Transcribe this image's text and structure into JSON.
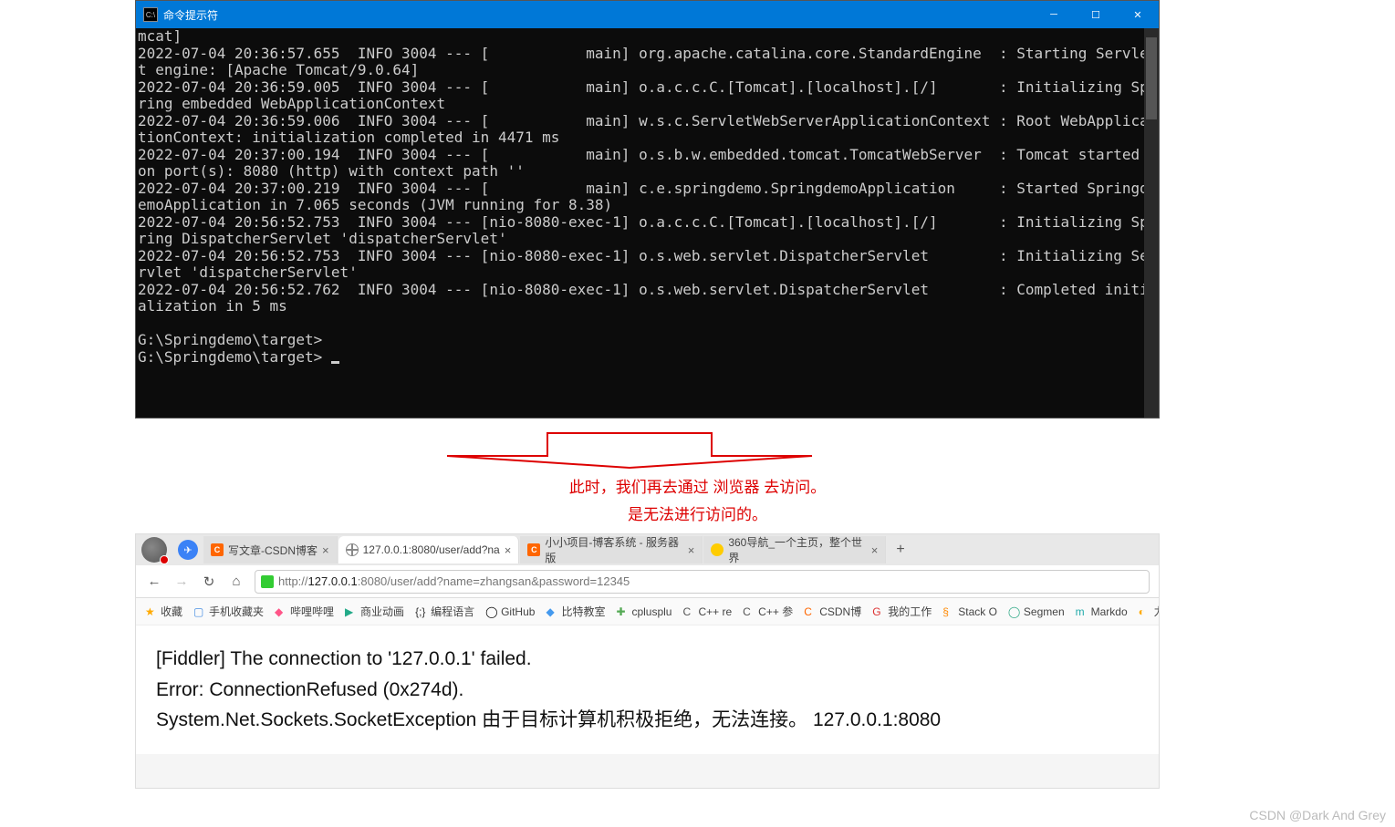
{
  "cmd": {
    "title": "命令提示符",
    "icon_text": "C:\\",
    "log": "mcat]\n2022-07-04 20:36:57.655  INFO 3004 --- [           main] org.apache.catalina.core.StandardEngine  : Starting Servlet engine: [Apache Tomcat/9.0.64]\n2022-07-04 20:36:59.005  INFO 3004 --- [           main] o.a.c.c.C.[Tomcat].[localhost].[/]       : Initializing Spring embedded WebApplicationContext\n2022-07-04 20:36:59.006  INFO 3004 --- [           main] w.s.c.ServletWebServerApplicationContext : Root WebApplicationContext: initialization completed in 4471 ms\n2022-07-04 20:37:00.194  INFO 3004 --- [           main] o.s.b.w.embedded.tomcat.TomcatWebServer  : Tomcat started on port(s): 8080 (http) with context path ''\n2022-07-04 20:37:00.219  INFO 3004 --- [           main] c.e.springdemo.SpringdemoApplication     : Started SpringdemoApplication in 7.065 seconds (JVM running for 8.38)\n2022-07-04 20:56:52.753  INFO 3004 --- [nio-8080-exec-1] o.a.c.c.C.[Tomcat].[localhost].[/]       : Initializing Spring DispatcherServlet 'dispatcherServlet'\n2022-07-04 20:56:52.753  INFO 3004 --- [nio-8080-exec-1] o.s.web.servlet.DispatcherServlet        : Initializing Servlet 'dispatcherServlet'\n2022-07-04 20:56:52.762  INFO 3004 --- [nio-8080-exec-1] o.s.web.servlet.DispatcherServlet        : Completed initialization in 5 ms\n\nG:\\Springdemo\\target>\nG:\\Springdemo\\target> "
  },
  "annotation": {
    "line1": "此时，我们再去通过 浏览器 去访问。",
    "line2": "是无法进行访问的。"
  },
  "browser": {
    "tabs": [
      {
        "label": "写文章-CSDN博客",
        "fav": "orange",
        "fav_text": "C"
      },
      {
        "label": "127.0.0.1:8080/user/add?na",
        "fav": "globe"
      },
      {
        "label": "小小项目-博客系统 - 服务器版",
        "fav": "orange",
        "fav_text": "C"
      },
      {
        "label": "360导航_一个主页，整个世界",
        "fav": "yellow"
      }
    ],
    "url_prefix": "http://",
    "url_host": "127.0.0.1",
    "url_rest": ":8080/user/add?name=zhangsan&password=12345",
    "bookmarks": [
      {
        "text": "收藏",
        "color": "#fa0",
        "glyph": "★"
      },
      {
        "text": "手机收藏夹",
        "color": "#4a90e2",
        "glyph": "▢"
      },
      {
        "text": "哔哩哔哩",
        "color": "#f58",
        "glyph": "◆"
      },
      {
        "text": "商业动画",
        "color": "#2a8",
        "glyph": "▶"
      },
      {
        "text": "编程语言",
        "color": "#333",
        "glyph": "{;}"
      },
      {
        "text": "GitHub",
        "color": "#000",
        "glyph": "◯"
      },
      {
        "text": "比特教室",
        "color": "#49e",
        "glyph": "◆"
      },
      {
        "text": "cplusplu",
        "color": "#5a5",
        "glyph": "✚"
      },
      {
        "text": "C++ re",
        "color": "#555",
        "glyph": "C"
      },
      {
        "text": "C++ 参",
        "color": "#555",
        "glyph": "C"
      },
      {
        "text": "CSDN博",
        "color": "#f60",
        "glyph": "C"
      },
      {
        "text": "我的工作",
        "color": "#d33",
        "glyph": "G"
      },
      {
        "text": "Stack O",
        "color": "#f80",
        "glyph": "§"
      },
      {
        "text": "Segmen",
        "color": "#3a8",
        "glyph": "◯"
      },
      {
        "text": "Markdo",
        "color": "#2aa",
        "glyph": "m"
      },
      {
        "text": "力扣 (",
        "color": "#fa0",
        "glyph": "◐"
      }
    ],
    "page": {
      "line1": "[Fiddler] The connection to '127.0.0.1' failed.",
      "line2": "Error: ConnectionRefused (0x274d).",
      "line3": "System.Net.Sockets.SocketException 由于目标计算机积极拒绝，无法连接。 127.0.0.1:8080"
    }
  },
  "watermark": "CSDN @Dark And Grey"
}
